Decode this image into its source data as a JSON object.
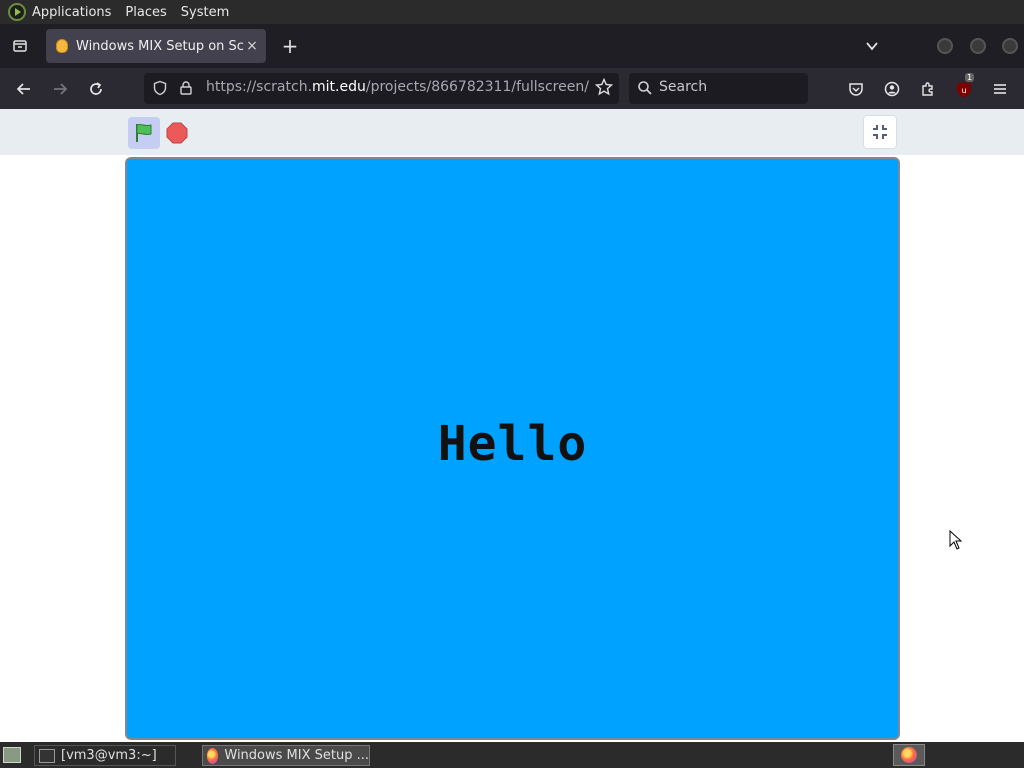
{
  "desktop_panel": {
    "menus": [
      "Applications",
      "Places",
      "System"
    ]
  },
  "browser": {
    "tab": {
      "title": "Windows MIX Setup on Scratch",
      "close_glyph": "×"
    },
    "new_tab_glyph": "+",
    "url": {
      "prefix": "https://scratch.",
      "host": "mit.edu",
      "path": "/projects/866782311/fullscreen/"
    },
    "search": {
      "placeholder": "Search"
    },
    "extension_badge": "1"
  },
  "stage": {
    "text": "Hello",
    "background_color": "#00a2ff"
  },
  "taskbar": {
    "tasks": [
      {
        "label": "[vm3@vm3:~]"
      },
      {
        "label": "Windows MIX Setup ..."
      }
    ]
  },
  "icons": {
    "green_flag": "green-flag-icon",
    "stop": "stop-icon",
    "unfullscreen": "unfullscreen-icon"
  }
}
